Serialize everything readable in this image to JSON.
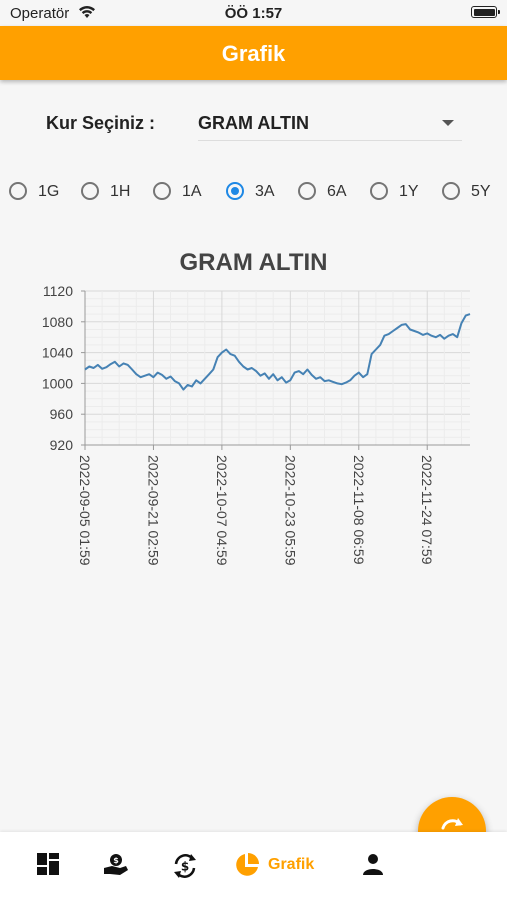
{
  "status_bar": {
    "carrier": "Operatör",
    "time": "ÖÖ 1:57"
  },
  "app_bar": {
    "title": "Grafik"
  },
  "selector": {
    "label": "Kur Seçiniz :",
    "value": "GRAM ALTIN"
  },
  "periods": [
    {
      "label": "1G",
      "selected": false
    },
    {
      "label": "1H",
      "selected": false
    },
    {
      "label": "1A",
      "selected": false
    },
    {
      "label": "3A",
      "selected": true
    },
    {
      "label": "6A",
      "selected": false
    },
    {
      "label": "1Y",
      "selected": false
    },
    {
      "label": "5Y",
      "selected": false
    }
  ],
  "chart_data": {
    "type": "line",
    "title": "GRAM ALTIN",
    "ylim": [
      920,
      1120
    ],
    "yticks": [
      920,
      960,
      1000,
      1040,
      1080,
      1120
    ],
    "xticks": [
      "2022-09-05 01:59",
      "2022-09-21 02:59",
      "2022-10-07 04:59",
      "2022-10-23 05:59",
      "2022-11-08 06:59",
      "2022-11-24 07:59"
    ],
    "x_index_range": [
      0,
      90
    ],
    "xtick_index": [
      0,
      16,
      32,
      48,
      64,
      80
    ],
    "grid": true,
    "line_color": "#4682b4",
    "series": [
      {
        "values": [
          1018,
          1022,
          1020,
          1024,
          1019,
          1021,
          1025,
          1028,
          1022,
          1026,
          1024,
          1018,
          1012,
          1008,
          1010,
          1012,
          1008,
          1014,
          1011,
          1006,
          1009,
          1003,
          1000,
          992,
          998,
          996,
          1004,
          1000,
          1006,
          1012,
          1018,
          1034,
          1040,
          1044,
          1038,
          1036,
          1028,
          1022,
          1018,
          1020,
          1016,
          1010,
          1013,
          1006,
          1012,
          1004,
          1008,
          1001,
          1004,
          1014,
          1016,
          1012,
          1018,
          1011,
          1006,
          1008,
          1003,
          1004,
          1002,
          1000,
          999,
          1001,
          1004,
          1010,
          1014,
          1008,
          1012,
          1038,
          1044,
          1050,
          1062,
          1064,
          1068,
          1072,
          1076,
          1077,
          1070,
          1068,
          1066,
          1063,
          1065,
          1062,
          1060,
          1063,
          1058,
          1062,
          1064,
          1060,
          1078,
          1088,
          1090
        ]
      }
    ]
  },
  "bottom_nav": {
    "items": [
      {
        "icon": "dashboard-icon",
        "label": ""
      },
      {
        "icon": "money-hand-icon",
        "label": ""
      },
      {
        "icon": "currency-exchange-icon",
        "label": ""
      },
      {
        "icon": "pie-chart-icon",
        "label": "Grafik",
        "active": true
      },
      {
        "icon": "person-icon",
        "label": ""
      }
    ]
  },
  "fab": {
    "icon": "refresh-icon"
  },
  "colors": {
    "accent": "#ffa000",
    "radio_selected": "#1e88e5",
    "line": "#4682b4"
  }
}
